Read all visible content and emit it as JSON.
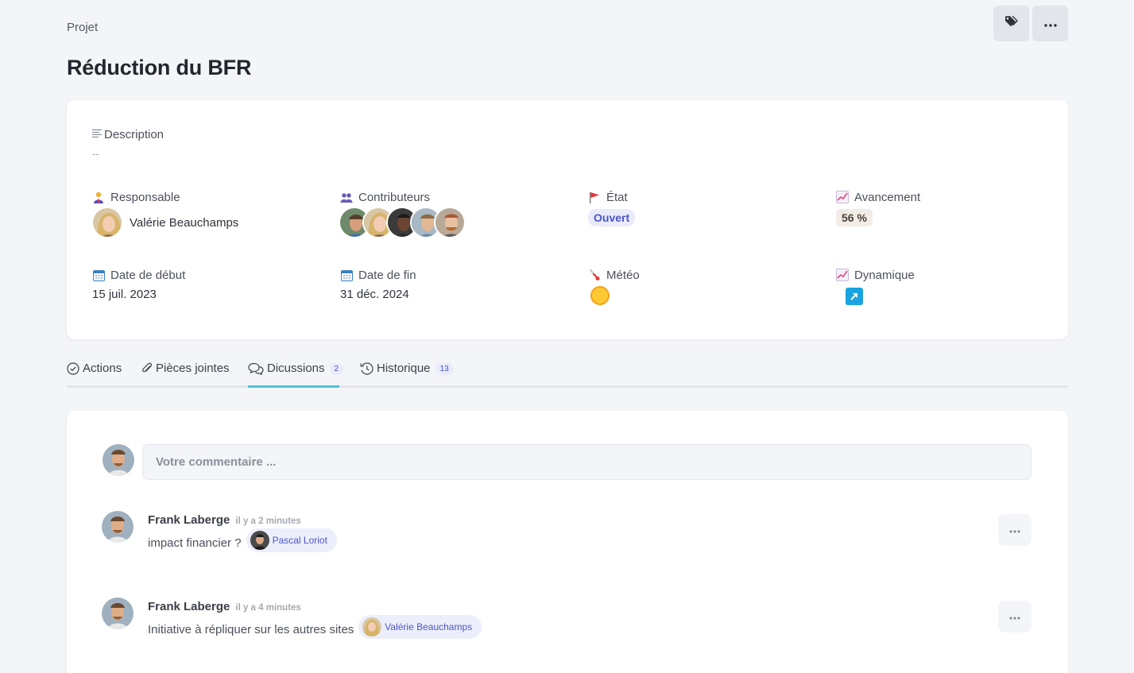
{
  "header": {
    "breadcrumb": "Projet",
    "title": "Réduction du BFR",
    "actions": [
      {
        "icon": "tag-icon"
      },
      {
        "icon": "more-horizontal-icon"
      }
    ]
  },
  "info": {
    "description": {
      "label": "Description",
      "value": "--"
    },
    "responsable": {
      "label": "Responsable",
      "name": "Valérie Beauchamps"
    },
    "contributeurs": {
      "label": "Contributeurs",
      "count": 5
    },
    "etat": {
      "label": "État",
      "value": "Ouvert"
    },
    "avancement": {
      "label": "Avancement",
      "value": "56 %"
    },
    "date_debut": {
      "label": "Date de début",
      "value": "15 juil. 2023"
    },
    "date_fin": {
      "label": "Date de fin",
      "value": "31 déc. 2024"
    },
    "meteo": {
      "label": "Météo",
      "icon": "sun-icon"
    },
    "dynamique": {
      "label": "Dynamique",
      "icon": "trend-up-arrow-icon"
    }
  },
  "tabs": [
    {
      "label": "Actions",
      "icon": "check-circle-icon"
    },
    {
      "label": "Pièces jointes",
      "icon": "paperclip-icon"
    },
    {
      "label": "Dicussions",
      "icon": "chat-bubbles-icon",
      "count": "2",
      "active": true
    },
    {
      "label": "Historique",
      "icon": "history-icon",
      "count": "13"
    }
  ],
  "discussion": {
    "placeholder": "Votre commentaire ...",
    "comments": [
      {
        "author": "Frank Laberge",
        "time": "il y a 2 minutes",
        "text": "impact financier ?",
        "mention": "Pascal Loriot"
      },
      {
        "author": "Frank Laberge",
        "time": "il y a 4 minutes",
        "text": "Initiative à répliquer sur les autres sites",
        "mention": "Valérie Beauchamps"
      }
    ]
  },
  "colors": {
    "accent_tab": "#4fc1d8",
    "badge_text": "#4b55c7",
    "trend_box": "#1aa3e0"
  }
}
